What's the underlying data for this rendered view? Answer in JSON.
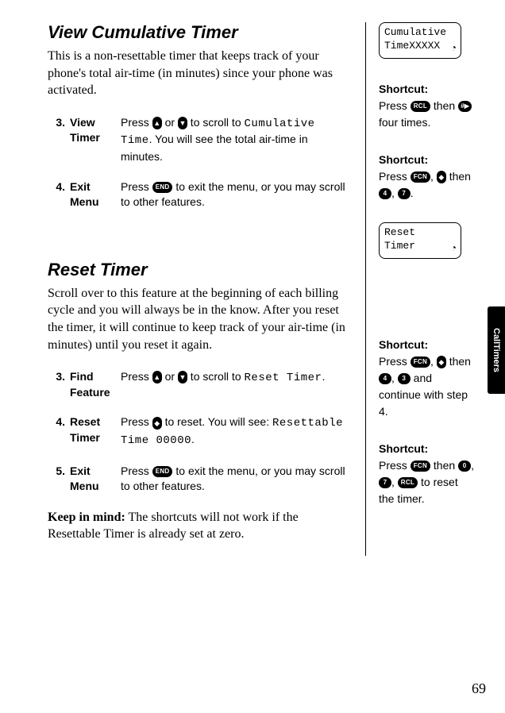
{
  "section1": {
    "title": "View Cumulative Timer",
    "intro": "This is a non-resettable timer that keeps track of your phone's total air-time (in minutes) since your phone was activated.",
    "steps": [
      {
        "num": "3.",
        "label": "View Timer",
        "pre": "Press ",
        "mid": " or ",
        "post1": " to scroll to ",
        "target": "Cumulative Time",
        "post2": ". You will see the total air-time in minutes."
      },
      {
        "num": "4.",
        "label": "Exit Menu",
        "pre": "Press ",
        "post": " to exit the menu, or you may scroll to other features."
      }
    ]
  },
  "section2": {
    "title": "Reset Timer",
    "intro": "Scroll over to this feature at the beginning of each billing cycle and you will always be in the know. After you reset the timer, it will continue to keep track of your air-time (in minutes) until you reset it again.",
    "steps": [
      {
        "num": "3.",
        "label": "Find Feature",
        "pre": "Press ",
        "mid": " or ",
        "post1": " to scroll to ",
        "target": "Reset Timer",
        "post2": "."
      },
      {
        "num": "4.",
        "label": "Reset Timer",
        "pre": "Press ",
        "post1": " to reset. You will see: ",
        "target": "Resettable Time 00000",
        "post2": "."
      },
      {
        "num": "5.",
        "label": "Exit Menu",
        "pre": "Press ",
        "post": " to exit the menu, or you may scroll to other features."
      }
    ],
    "keep_label": "Keep in mind:",
    "keep_text": " The shortcuts will not work if the Resettable Timer is already set at zero."
  },
  "screens": {
    "cumulative": {
      "line1": "Cumulative",
      "line2": "TimeXXXXX",
      "clock": "◔"
    },
    "reset": {
      "line1": "Reset",
      "line2": "Timer",
      "clock": "◔"
    }
  },
  "shortcuts": {
    "s1": {
      "hd": "Shortcut:",
      "a": "Press ",
      "b": " then ",
      "c": " four times."
    },
    "s2": {
      "hd": "Shortcut:",
      "a": "Press ",
      "b": ", ",
      "c": " then ",
      "d": ", ",
      "e": "."
    },
    "s3": {
      "hd": "Shortcut:",
      "a": "Press ",
      "b": ", ",
      "c": " then ",
      "d": ", ",
      "e": " and continue with step 4."
    },
    "s4": {
      "hd": "Shortcut:",
      "a": "Press ",
      "b": " then ",
      "c": ", ",
      "d": ", ",
      "e": " to reset the timer."
    }
  },
  "keys": {
    "up": "▲",
    "down": "▼",
    "updown": "◆",
    "RCL": "RCL",
    "END": "END",
    "FCN": "FCN",
    "hash": "#▶",
    "k0": "0",
    "k3": "3",
    "k4": "4",
    "k7": "7"
  },
  "tab": "CallTimers",
  "page": "69"
}
